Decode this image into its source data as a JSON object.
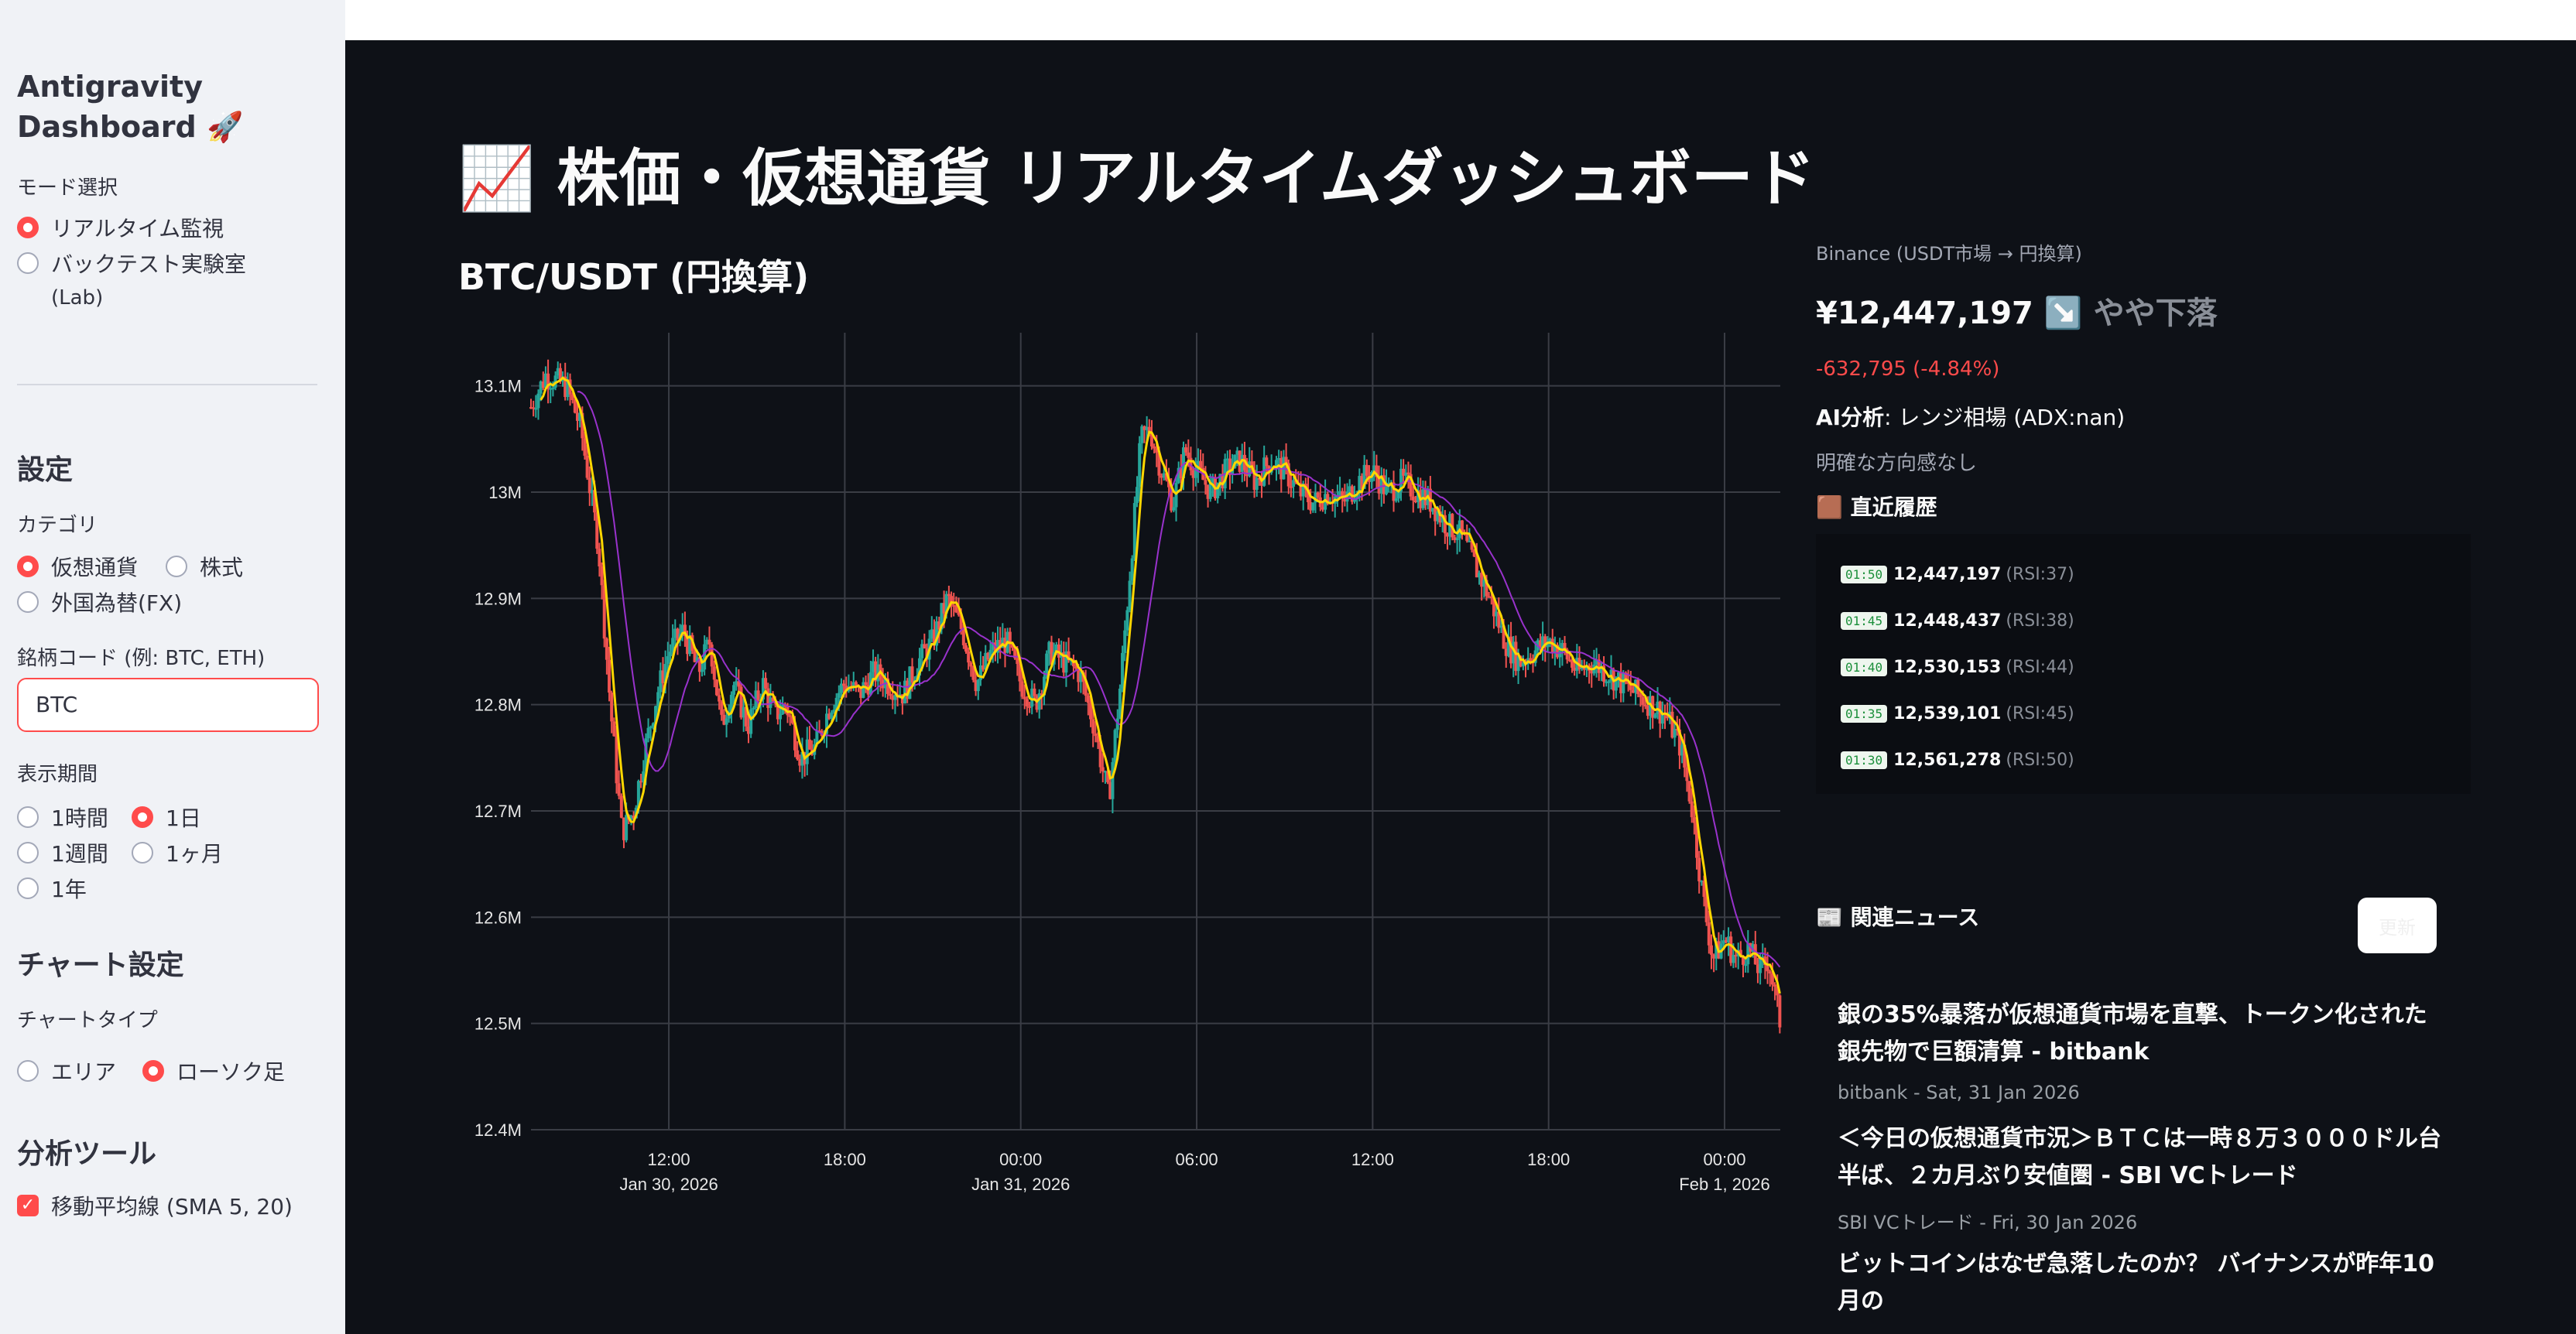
{
  "sidebar": {
    "title": "Antigravity Dashboard 🚀",
    "mode_label": "モード選択",
    "mode_options": [
      "リアルタイム監視",
      "バックテスト実験室",
      "(Lab)"
    ],
    "settings_heading": "設定",
    "category_label": "カテゴリ",
    "category_options": [
      "仮想通貨",
      "株式",
      "外国為替(FX)"
    ],
    "symbol_label": "銘柄コード (例: BTC, ETH)",
    "symbol_value": "BTC",
    "period_label": "表示期間",
    "period_options": [
      "1時間",
      "1日",
      "1週間",
      "1ヶ月",
      "1年"
    ],
    "chart_settings_heading": "チャート設定",
    "chart_type_label": "チャートタイプ",
    "chart_type_options": [
      "エリア",
      "ローソク足"
    ],
    "analysis_heading": "分析ツール",
    "sma_label": "移動平均線 (SMA 5, 20)"
  },
  "main": {
    "title": "📈 株価・仮想通貨 リアルタイムダッシュボード",
    "chart_title": "BTC/USDT (円換算)"
  },
  "chart_data": {
    "type": "candlestick",
    "y_tick_labels": [
      "13.1M",
      "13M",
      "12.9M",
      "12.8M",
      "12.7M",
      "12.6M",
      "12.5M",
      "12.4M"
    ],
    "ylim": [
      12400000,
      13150000
    ],
    "x_tick_labels": [
      {
        "time": "12:00",
        "date": "Jan 30, 2026"
      },
      {
        "time": "18:00",
        "date": ""
      },
      {
        "time": "00:00",
        "date": "Jan 31, 2026"
      },
      {
        "time": "06:00",
        "date": ""
      },
      {
        "time": "12:00",
        "date": ""
      },
      {
        "time": "18:00",
        "date": ""
      },
      {
        "time": "00:00",
        "date": "Feb 1, 2026"
      }
    ],
    "xlim_hours_from_jan30_00": [
      7.3,
      49.9
    ],
    "trend": {
      "hours": [
        7.3,
        7.8,
        8.5,
        9.0,
        9.6,
        10.0,
        10.4,
        10.8,
        11.2,
        11.6,
        12.0,
        12.5,
        13.0,
        13.4,
        13.8,
        14.2,
        14.7,
        15.2,
        15.6,
        16.0,
        16.5,
        17.0,
        17.5,
        18.0,
        18.5,
        19.0,
        19.5,
        20.0,
        20.5,
        21.0,
        21.5,
        22.0,
        22.5,
        23.0,
        23.5,
        24.0,
        24.5,
        25.0,
        25.5,
        26.0,
        26.5,
        27.0,
        27.4,
        27.8,
        28.1,
        28.4,
        28.8,
        29.2,
        29.6,
        30.0,
        30.5,
        31.0,
        31.5,
        32.0,
        32.5,
        33.0,
        33.5,
        34.0,
        34.5,
        35.0,
        35.5,
        36.0,
        36.5,
        37.0,
        37.5,
        38.0,
        38.5,
        39.0,
        39.5,
        40.0,
        40.5,
        41.0,
        41.5,
        42.0,
        42.5,
        43.0,
        43.5,
        44.0,
        44.5,
        45.0,
        45.5,
        46.0,
        46.5,
        46.9,
        47.2,
        47.6,
        48.0,
        48.4,
        48.8,
        49.2,
        49.5,
        49.9
      ],
      "price": [
        13080000,
        13110000,
        13100000,
        13060000,
        12950000,
        12800000,
        12680000,
        12700000,
        12760000,
        12810000,
        12850000,
        12870000,
        12830000,
        12860000,
        12780000,
        12820000,
        12780000,
        12820000,
        12790000,
        12800000,
        12750000,
        12760000,
        12800000,
        12820000,
        12810000,
        12830000,
        12820000,
        12810000,
        12840000,
        12860000,
        12900000,
        12870000,
        12820000,
        12850000,
        12860000,
        12820000,
        12800000,
        12850000,
        12840000,
        12830000,
        12780000,
        12710000,
        12820000,
        12950000,
        13050000,
        13060000,
        13020000,
        12990000,
        13040000,
        13020000,
        13000000,
        13020000,
        13030000,
        13010000,
        13030000,
        13020000,
        13000000,
        12990000,
        13000000,
        12990000,
        13010000,
        13020000,
        13000000,
        13010000,
        13000000,
        12990000,
        12970000,
        12960000,
        12930000,
        12900000,
        12860000,
        12840000,
        12850000,
        12860000,
        12850000,
        12830000,
        12840000,
        12830000,
        12820000,
        12810000,
        12800000,
        12790000,
        12760000,
        12700000,
        12630000,
        12560000,
        12580000,
        12560000,
        12570000,
        12550000,
        12560000,
        12500000
      ]
    },
    "series": [
      {
        "name": "SMA 5",
        "color": "#ffd700"
      },
      {
        "name": "SMA 20",
        "color": "#9932cc"
      }
    ],
    "grid": true
  },
  "right_panel": {
    "source_label": "Binance (USDT市場 → 円換算)",
    "price": "¥12,447,197",
    "trend_arrow": "↘️",
    "trend_text": "やや下落",
    "change": "-632,795 (-4.84%)",
    "ai_label": "AI分析",
    "ai_value": ": レンジ相場 (ADX:nan)",
    "ai_note": "明確な方向感なし",
    "history_heading": "🟫 直近履歴",
    "history": [
      {
        "time": "01:50",
        "value": "12,447,197",
        "rsi": "(RSI:37)"
      },
      {
        "time": "01:45",
        "value": "12,448,437",
        "rsi": "(RSI:38)"
      },
      {
        "time": "01:40",
        "value": "12,530,153",
        "rsi": "(RSI:44)"
      },
      {
        "time": "01:35",
        "value": "12,539,101",
        "rsi": "(RSI:45)"
      },
      {
        "time": "01:30",
        "value": "12,561,278",
        "rsi": "(RSI:50)"
      }
    ],
    "news_heading": "📰 関連ニュース",
    "refresh_label": "更新",
    "news": [
      {
        "title": "銀の35%暴落が仮想通貨市場を直撃、トークン化された銀先物で巨額清算 - bitbank",
        "meta": "bitbank - Sat, 31 Jan 2026"
      },
      {
        "title": "＜今日の仮想通貨市況＞ＢＴＣは一時８万３０００ドル台半ば、２カ月ぶり安値圏 - SBI VCトレード",
        "meta": "SBI VCトレード - Fri, 30 Jan 2026"
      },
      {
        "title": "ビットコインはなぜ急落したのか？ バイナンスが昨年10月の",
        "meta": ""
      }
    ]
  },
  "colors": {
    "accent": "#ff4b4b",
    "up_candle": "#26a69a",
    "down_candle": "#ef5350",
    "negative_change": "#ff4b4b",
    "app_bg": "#0e1117",
    "sidebar_bg": "#f0f2f6"
  }
}
